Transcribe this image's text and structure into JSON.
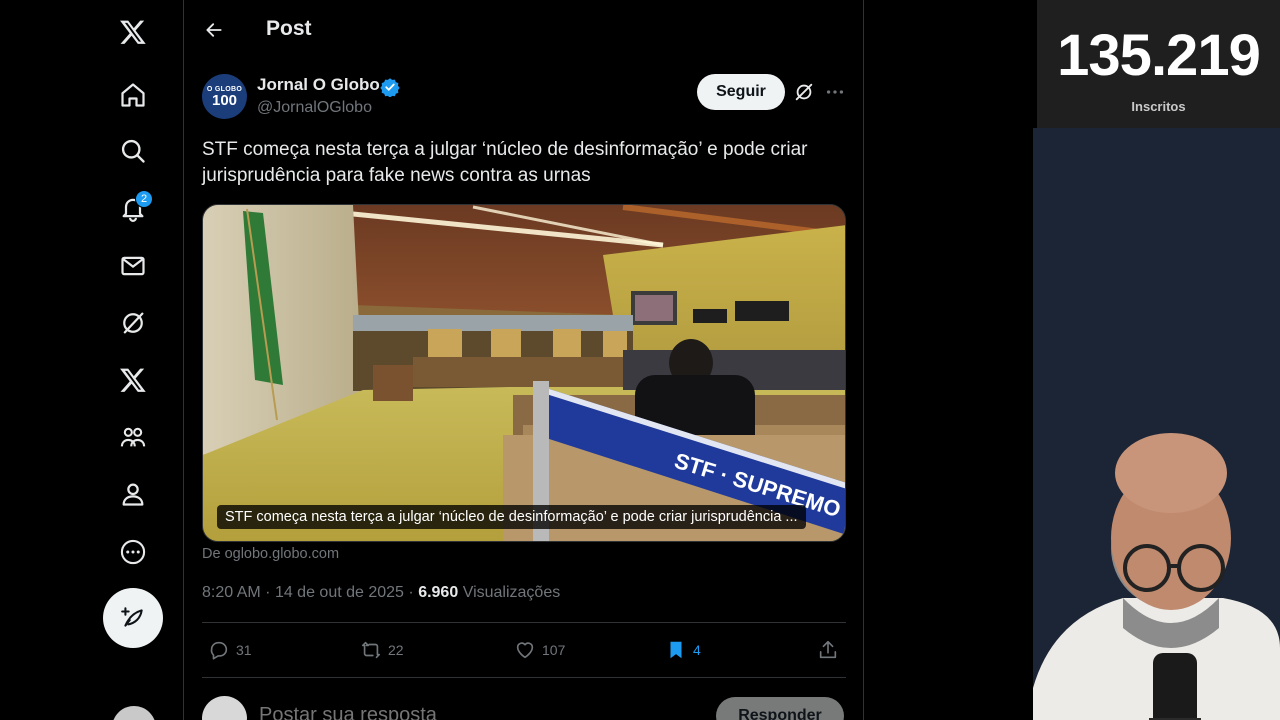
{
  "nav": {
    "notifications_badge": "2",
    "items": [
      "x-logo",
      "home",
      "search",
      "notifications",
      "messages",
      "grok",
      "premium",
      "communities",
      "profile",
      "more"
    ]
  },
  "header": {
    "title": "Post"
  },
  "post": {
    "author_name": "Jornal O Globo",
    "author_handle": "@JornalOGlobo",
    "avatar_text_top": "O GLOBO",
    "avatar_text_bottom": "100",
    "follow_label": "Seguir",
    "text": "STF começa nesta terça a julgar ‘núcleo de desinformação’ e pode criar jurisprudência para fake news contra as urnas",
    "media_caption": "STF começa nesta terça a julgar ‘núcleo de desinformação’ e pode criar jurisprudência ...",
    "media_banner_text": "STF · SUPREMO TRIBUNAL FEDERAL",
    "source": "De oglobo.globo.com",
    "time": "8:20 AM",
    "date": "14 de out de 2025",
    "views_count": "6.960",
    "views_label": "Visualizações"
  },
  "actions": {
    "replies": "31",
    "reposts": "22",
    "likes": "107",
    "bookmarks": "4"
  },
  "reply": {
    "placeholder": "Postar sua resposta",
    "button_label": "Responder"
  },
  "overlay": {
    "subscribers": "135.219",
    "subscribers_label": "Inscritos"
  },
  "colors": {
    "background": "#000000",
    "accent": "#1d9bf0",
    "text_primary": "#e7e9ea",
    "text_secondary": "#71767b",
    "border": "#2f3336"
  }
}
